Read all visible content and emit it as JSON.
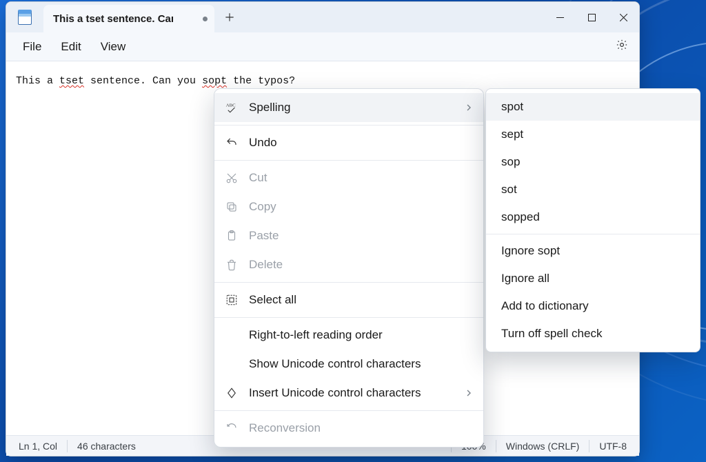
{
  "titlebar": {
    "tab_title": "This a tset sentence. Caı",
    "dirty": true
  },
  "menubar": {
    "file": "File",
    "edit": "Edit",
    "view": "View"
  },
  "editor": {
    "pre1": "This a ",
    "typo1": "tset",
    "mid1": " sentence. Can you ",
    "typo2": "sopt",
    "post1": " the typos?"
  },
  "context_menu": {
    "spelling": "Spelling",
    "undo": "Undo",
    "cut": "Cut",
    "copy": "Copy",
    "paste": "Paste",
    "delete": "Delete",
    "select_all": "Select all",
    "rtl": "Right-to-left reading order",
    "show_unicode": "Show Unicode control characters",
    "insert_unicode": "Insert Unicode control characters",
    "reconversion": "Reconversion"
  },
  "spelling_submenu": {
    "s1": "spot",
    "s2": "sept",
    "s3": "sop",
    "s4": "sot",
    "s5": "sopped",
    "ignore_once": "Ignore sopt",
    "ignore_all": "Ignore all",
    "add_dict": "Add to dictionary",
    "turn_off": "Turn off spell check"
  },
  "statusbar": {
    "position": "Ln 1, Col",
    "charcount": "46 characters",
    "zoom": "100%",
    "line_ending": "Windows (CRLF)",
    "encoding": "UTF-8"
  }
}
